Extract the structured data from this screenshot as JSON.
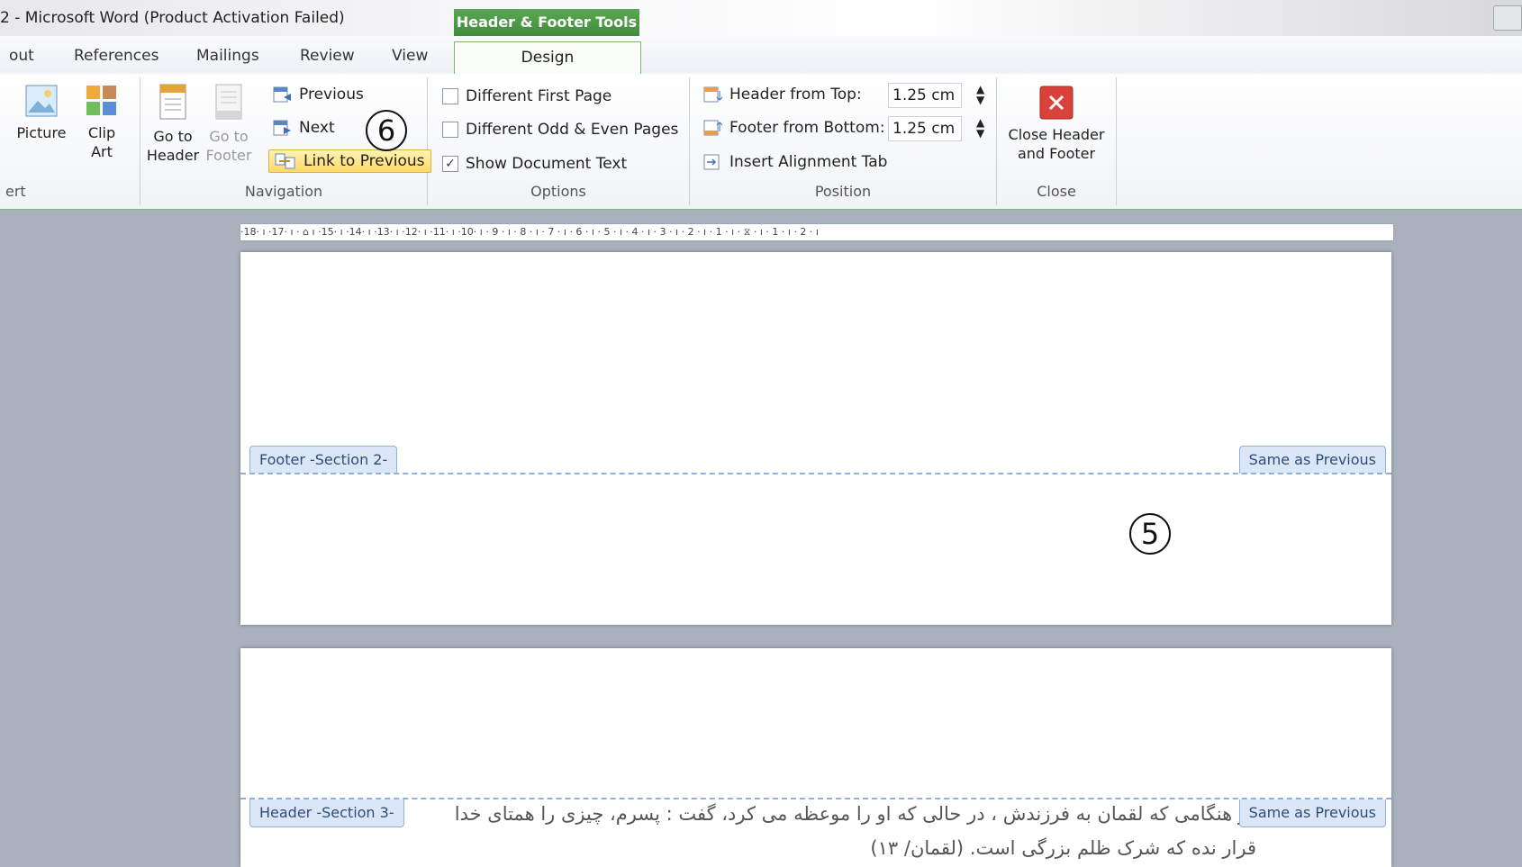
{
  "window": {
    "title": "2 - Microsoft Word (Product Activation Failed)",
    "contextual_tab": "Header & Footer Tools"
  },
  "tabs": [
    {
      "label": "out"
    },
    {
      "label": "References"
    },
    {
      "label": "Mailings"
    },
    {
      "label": "Review"
    },
    {
      "label": "View"
    },
    {
      "label": "Design",
      "active": true
    }
  ],
  "ribbon": {
    "insert": {
      "picture": "Picture",
      "clip_line1": "Clip",
      "clip_line2": "Art",
      "label": "ert"
    },
    "navigation": {
      "goto_header_1": "Go to",
      "goto_header_2": "Header",
      "goto_footer_1": "Go to",
      "goto_footer_2": "Footer",
      "previous": "Previous",
      "next": "Next",
      "link_to_previous": "Link to Previous",
      "label": "Navigation"
    },
    "options": {
      "different_first_page": "Different First Page",
      "different_odd_even": "Different Odd & Even Pages",
      "show_document_text": "Show Document Text",
      "show_document_text_checked": true,
      "label": "Options"
    },
    "position": {
      "header_from_top": "Header from Top:",
      "header_value": "1.25 cm",
      "footer_from_bottom": "Footer from Bottom:",
      "footer_value": "1.25 cm",
      "insert_alignment_tab": "Insert Alignment Tab",
      "label": "Position"
    },
    "close": {
      "line1": "Close Header",
      "line2": "and Footer",
      "label": "Close"
    }
  },
  "callouts": {
    "six": "6",
    "five": "5"
  },
  "ruler": {
    "text": "·18· ı ·17· ı · ⌂ ı ·15· ı ·14· ı ·13· ı ·12· ı ·11· ı ·10· ı · 9 · ı · 8 · ı · 7 · ı · 6 · ı · 5 · ı · 4 · ı · 3 · ı · 2 · ı · 1 · ı · ⧖ · ı · 1 · ı · 2 · ı"
  },
  "page1": {
    "footer_tag": "Footer -Section 2-",
    "same_as_previous": "Same as Previous"
  },
  "page2": {
    "header_tag": "Header -Section 3-",
    "same_as_previous": "Same as Previous",
    "text_line1": "و هنگامی که لقمان به فرزندش ، در حالی که او را موعظه می کرد، گفت : پسرم، چیزی را همتای خدا",
    "text_line2": "قرار نده که شرک ظلم بزرگی است. (لقمان/ ۱۳)"
  },
  "colors": {
    "accent_green": "#4e9f47",
    "hf_blue": "#8fb0d8",
    "workspace": "#a9b1bd"
  }
}
